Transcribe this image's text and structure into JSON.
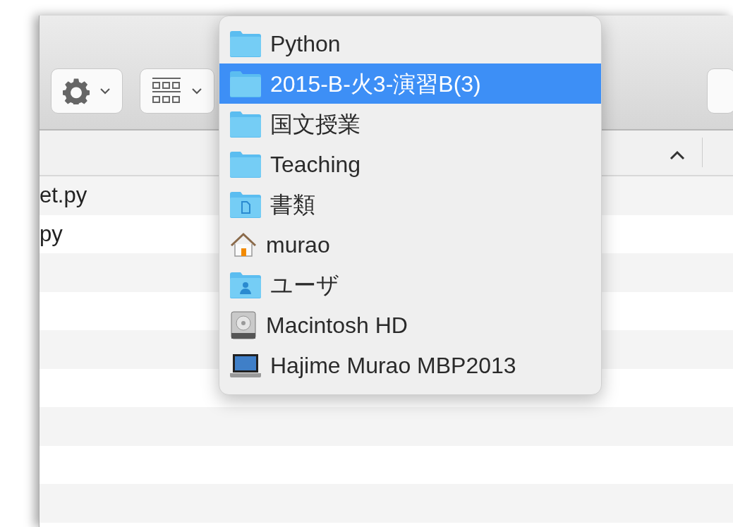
{
  "list_header": {
    "sort_ascending": true
  },
  "files": [
    {
      "name": "et.py"
    },
    {
      "name": "py"
    }
  ],
  "path_menu": {
    "items": [
      {
        "label": "Python",
        "kind": "folder",
        "selected": false
      },
      {
        "label": "2015-B-火3-演習B(3)",
        "kind": "folder",
        "selected": true
      },
      {
        "label": "国文授業",
        "kind": "folder",
        "selected": false
      },
      {
        "label": "Teaching",
        "kind": "folder",
        "selected": false
      },
      {
        "label": "書類",
        "kind": "documents",
        "selected": false
      },
      {
        "label": "murao",
        "kind": "home",
        "selected": false
      },
      {
        "label": "ユーザ",
        "kind": "users",
        "selected": false
      },
      {
        "label": "Macintosh HD",
        "kind": "disk",
        "selected": false
      },
      {
        "label": "Hajime Murao MBP2013",
        "kind": "computer",
        "selected": false
      }
    ]
  }
}
